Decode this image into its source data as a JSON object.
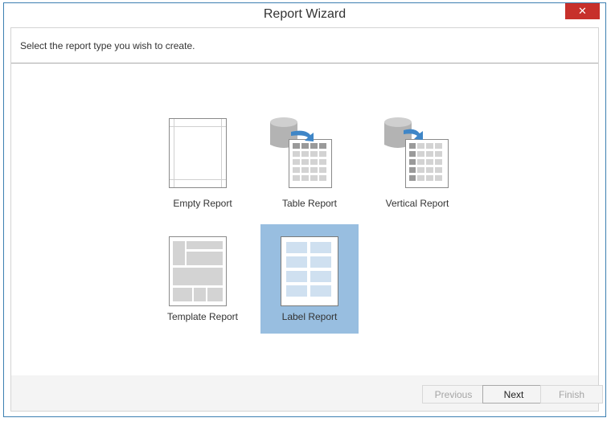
{
  "window": {
    "title": "Report Wizard",
    "close_icon": "close-icon"
  },
  "prompt": "Select the report type you wish to create.",
  "report_types": [
    {
      "label": "Empty Report",
      "icon": "empty-report-icon",
      "selected": false
    },
    {
      "label": "Table Report",
      "icon": "table-report-icon",
      "selected": false
    },
    {
      "label": "Vertical Report",
      "icon": "vertical-report-icon",
      "selected": false
    },
    {
      "label": "Template Report",
      "icon": "template-report-icon",
      "selected": false
    },
    {
      "label": "Label Report",
      "icon": "label-report-icon",
      "selected": true
    }
  ],
  "buttons": {
    "previous": "Previous",
    "next": "Next",
    "finish": "Finish"
  },
  "colors": {
    "selection": "#98bee0",
    "close_button": "#c7302b",
    "accent_arrow": "#3f86c7"
  }
}
